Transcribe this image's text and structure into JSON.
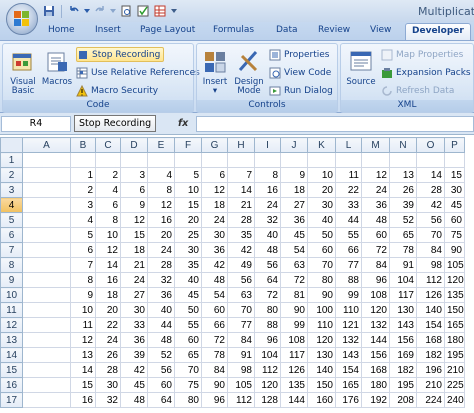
{
  "window": {
    "title": "Multiplicati"
  },
  "qat": {
    "icons": [
      "save-icon",
      "undo-icon",
      "dropdown-icon",
      "redo-icon",
      "dropdown-icon",
      "print-preview-icon",
      "spelling-icon",
      "table-icon",
      "customize-icon"
    ]
  },
  "tabs": [
    "Home",
    "Insert",
    "Page Layout",
    "Formulas",
    "Data",
    "Review",
    "View",
    "Developer"
  ],
  "active_tab": "Developer",
  "ribbon": {
    "code": {
      "label": "Code",
      "visual_basic": "Visual Basic",
      "macros": "Macros",
      "stop_recording": "Stop Recording",
      "relative_refs": "Use Relative References",
      "macro_security": "Macro Security"
    },
    "controls": {
      "label": "Controls",
      "insert": "Insert",
      "design_mode": "Design Mode",
      "properties": "Properties",
      "view_code": "View Code",
      "run_dialog": "Run Dialog"
    },
    "xml": {
      "label": "XML",
      "source": "Source",
      "map_properties": "Map Properties",
      "expansion_packs": "Expansion Packs",
      "refresh_data": "Refresh Data"
    }
  },
  "formula_bar": {
    "name_box": "R4",
    "tooltip": "Stop Recording",
    "fx": "fx",
    "value": ""
  },
  "sheet": {
    "columns": [
      "A",
      "B",
      "C",
      "D",
      "E",
      "F",
      "G",
      "H",
      "I",
      "J",
      "K",
      "L",
      "M",
      "N",
      "O",
      "P"
    ],
    "active_row": 4,
    "rows": [
      [
        "",
        "",
        "",
        "",
        "",
        "",
        "",
        "",
        "",
        "",
        "",
        "",
        "",
        "",
        "",
        ""
      ],
      [
        "",
        "1",
        "2",
        "3",
        "4",
        "5",
        "6",
        "7",
        "8",
        "9",
        "10",
        "11",
        "12",
        "13",
        "14",
        "15"
      ],
      [
        "",
        "2",
        "4",
        "6",
        "8",
        "10",
        "12",
        "14",
        "16",
        "18",
        "20",
        "22",
        "24",
        "26",
        "28",
        "30"
      ],
      [
        "",
        "3",
        "6",
        "9",
        "12",
        "15",
        "18",
        "21",
        "24",
        "27",
        "30",
        "33",
        "36",
        "39",
        "42",
        "45"
      ],
      [
        "",
        "4",
        "8",
        "12",
        "16",
        "20",
        "24",
        "28",
        "32",
        "36",
        "40",
        "44",
        "48",
        "52",
        "56",
        "60"
      ],
      [
        "",
        "5",
        "10",
        "15",
        "20",
        "25",
        "30",
        "35",
        "40",
        "45",
        "50",
        "55",
        "60",
        "65",
        "70",
        "75"
      ],
      [
        "",
        "6",
        "12",
        "18",
        "24",
        "30",
        "36",
        "42",
        "48",
        "54",
        "60",
        "66",
        "72",
        "78",
        "84",
        "90"
      ],
      [
        "",
        "7",
        "14",
        "21",
        "28",
        "35",
        "42",
        "49",
        "56",
        "63",
        "70",
        "77",
        "84",
        "91",
        "98",
        "105"
      ],
      [
        "",
        "8",
        "16",
        "24",
        "32",
        "40",
        "48",
        "56",
        "64",
        "72",
        "80",
        "88",
        "96",
        "104",
        "112",
        "120"
      ],
      [
        "",
        "9",
        "18",
        "27",
        "36",
        "45",
        "54",
        "63",
        "72",
        "81",
        "90",
        "99",
        "108",
        "117",
        "126",
        "135"
      ],
      [
        "",
        "10",
        "20",
        "30",
        "40",
        "50",
        "60",
        "70",
        "80",
        "90",
        "100",
        "110",
        "120",
        "130",
        "140",
        "150"
      ],
      [
        "",
        "11",
        "22",
        "33",
        "44",
        "55",
        "66",
        "77",
        "88",
        "99",
        "110",
        "121",
        "132",
        "143",
        "154",
        "165"
      ],
      [
        "",
        "12",
        "24",
        "36",
        "48",
        "60",
        "72",
        "84",
        "96",
        "108",
        "120",
        "132",
        "144",
        "156",
        "168",
        "180"
      ],
      [
        "",
        "13",
        "26",
        "39",
        "52",
        "65",
        "78",
        "91",
        "104",
        "117",
        "130",
        "143",
        "156",
        "169",
        "182",
        "195"
      ],
      [
        "",
        "14",
        "28",
        "42",
        "56",
        "70",
        "84",
        "98",
        "112",
        "126",
        "140",
        "154",
        "168",
        "182",
        "196",
        "210"
      ],
      [
        "",
        "15",
        "30",
        "45",
        "60",
        "75",
        "90",
        "105",
        "120",
        "135",
        "150",
        "165",
        "180",
        "195",
        "210",
        "225"
      ],
      [
        "",
        "16",
        "32",
        "48",
        "64",
        "80",
        "96",
        "112",
        "128",
        "144",
        "160",
        "176",
        "192",
        "208",
        "224",
        "240"
      ]
    ]
  }
}
